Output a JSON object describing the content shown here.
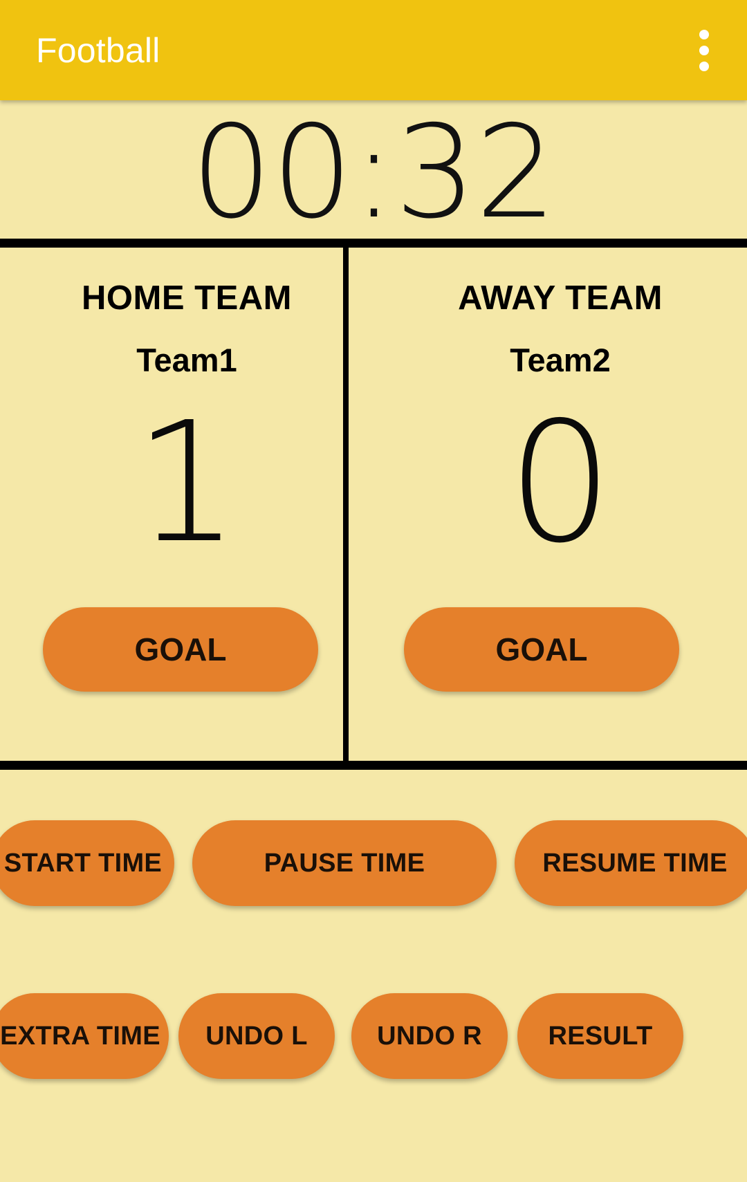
{
  "app": {
    "title": "Football",
    "overflow_menu_icon": "more-vertical-icon",
    "colors": {
      "appbar": "#F0C310",
      "background": "#F5E8A8",
      "button": "#E5802B",
      "divider": "#000000",
      "title_text": "#FFFFFF",
      "body_text": "#000000"
    }
  },
  "timer": {
    "value": "00:32"
  },
  "scoreboard": {
    "home": {
      "role": "HOME TEAM",
      "name": "Team1",
      "score": "1",
      "goal_label": "GOAL"
    },
    "away": {
      "role": "AWAY TEAM",
      "name": "Team2",
      "score": "0",
      "goal_label": "GOAL"
    }
  },
  "controls": {
    "row1": [
      {
        "label": "START TIME"
      },
      {
        "label": "PAUSE TIME"
      },
      {
        "label": "RESUME TIME"
      }
    ],
    "row2": [
      {
        "label": "EXTRA TIME"
      },
      {
        "label": "UNDO L"
      },
      {
        "label": "UNDO R"
      },
      {
        "label": "RESULT"
      }
    ]
  }
}
